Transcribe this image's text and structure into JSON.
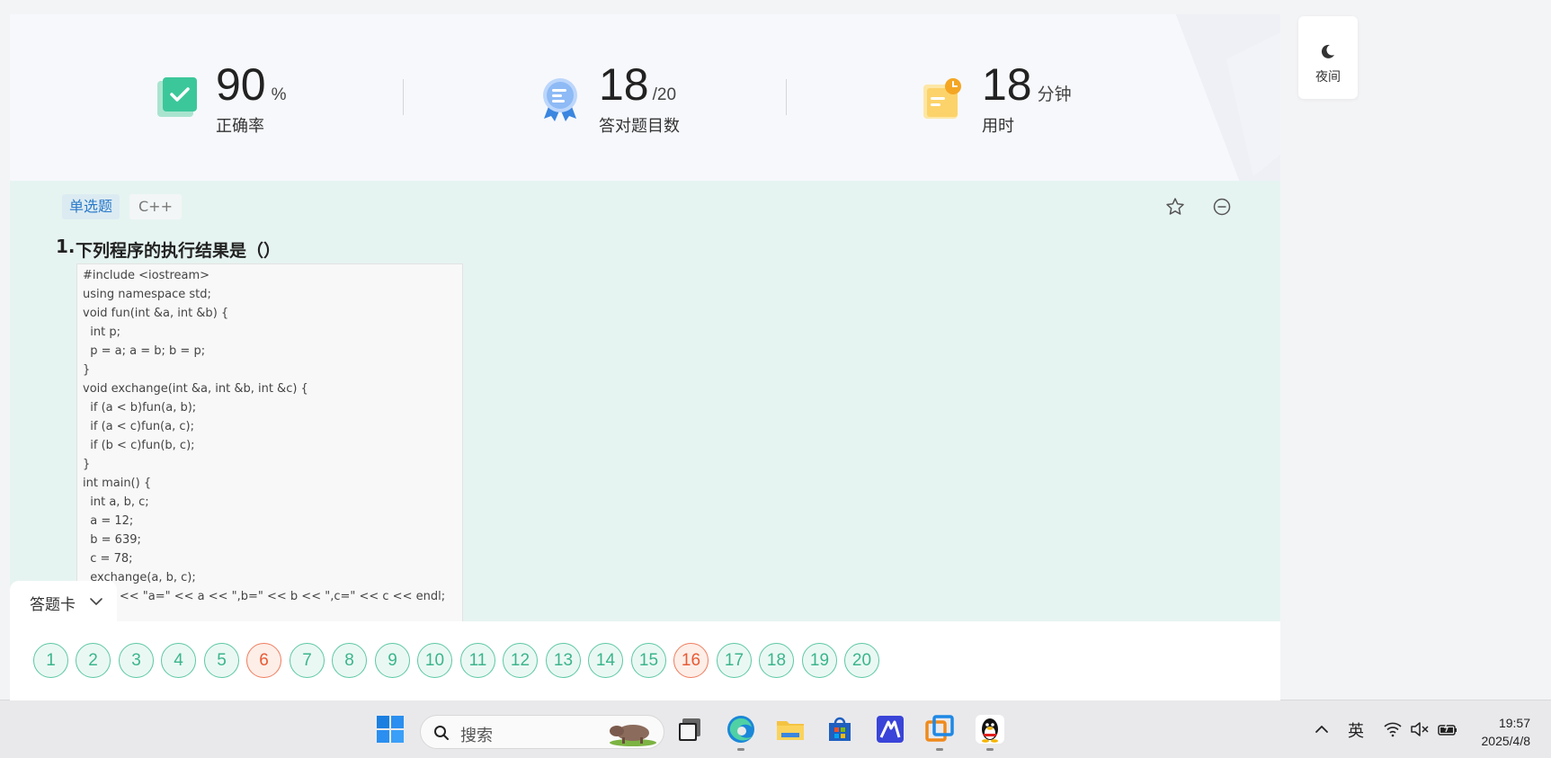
{
  "stats": {
    "accuracy": {
      "value": "90",
      "unit": "%",
      "caption": "正确率",
      "icon": "check-shield-icon"
    },
    "correct": {
      "value": "18",
      "unit": "/20",
      "caption": "答对题目数",
      "icon": "award-ribbon-icon"
    },
    "time": {
      "value": "18",
      "unit": "分钟",
      "caption": "用时",
      "icon": "clock-note-icon"
    }
  },
  "night_mode": {
    "label": "夜间",
    "icon": "moon-icon"
  },
  "question": {
    "type_tag": "单选题",
    "lang_tag": "C++",
    "number": "1.",
    "title": "下列程序的执行结果是（）",
    "code_lines": [
      "#include <iostream>",
      "using namespace std;",
      "void fun(int &a, int &b) {",
      "  int p;",
      "  p = a; a = b; b = p;",
      "}",
      "void exchange(int &a, int &b, int &c) {",
      "  if (a < b)fun(a, b);",
      "  if (a < c)fun(a, c);",
      "  if (b < c)fun(b, c);",
      "}",
      "int main() {",
      "  int a, b, c;",
      "  a = 12;",
      "  b = 639;",
      "  c = 78;",
      "  exchange(a, b, c);",
      "  cout << \"a=\" << a << \",b=\" << b << \",c=\" << c << endl;"
    ]
  },
  "answer_card": {
    "label": "答题卡",
    "items": [
      {
        "n": "1",
        "status": "correct"
      },
      {
        "n": "2",
        "status": "correct"
      },
      {
        "n": "3",
        "status": "correct"
      },
      {
        "n": "4",
        "status": "correct"
      },
      {
        "n": "5",
        "status": "correct"
      },
      {
        "n": "6",
        "status": "wrong"
      },
      {
        "n": "7",
        "status": "correct"
      },
      {
        "n": "8",
        "status": "correct"
      },
      {
        "n": "9",
        "status": "correct"
      },
      {
        "n": "10",
        "status": "correct"
      },
      {
        "n": "11",
        "status": "correct"
      },
      {
        "n": "12",
        "status": "correct"
      },
      {
        "n": "13",
        "status": "correct"
      },
      {
        "n": "14",
        "status": "correct"
      },
      {
        "n": "15",
        "status": "correct"
      },
      {
        "n": "16",
        "status": "wrong"
      },
      {
        "n": "17",
        "status": "correct"
      },
      {
        "n": "18",
        "status": "correct"
      },
      {
        "n": "19",
        "status": "correct"
      },
      {
        "n": "20",
        "status": "correct"
      }
    ]
  },
  "colors": {
    "correct": "#3bb58c",
    "wrong": "#e85a34",
    "accent": "#2979c8"
  },
  "taskbar": {
    "search_label": "搜索",
    "ime": "英",
    "time": "19:57",
    "date": "2025/4/8"
  }
}
